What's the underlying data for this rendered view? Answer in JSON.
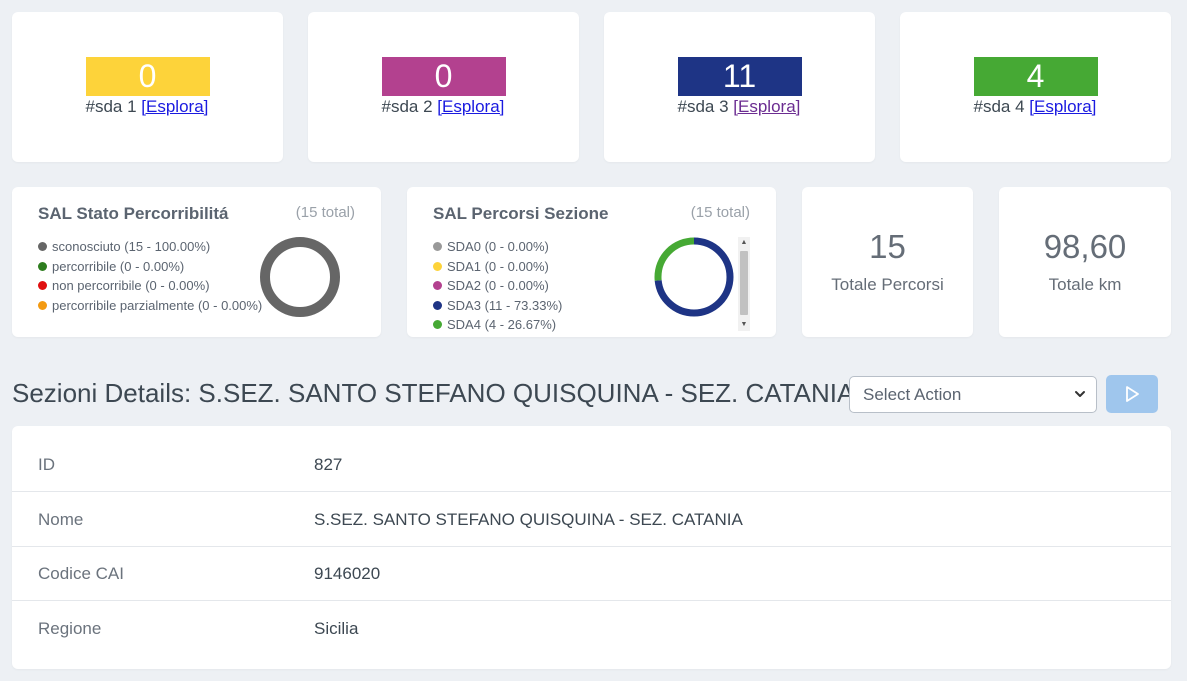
{
  "sda_cards": [
    {
      "count": "0",
      "label": "#sda 1",
      "link": "[Esplora]",
      "color": "#fdd33a"
    },
    {
      "count": "0",
      "label": "#sda 2",
      "link": "[Esplora]",
      "color": "#b3418f"
    },
    {
      "count": "11",
      "label": "#sda 3",
      "link": "[Esplora]",
      "color": "#1e3485"
    },
    {
      "count": "4",
      "label": "#sda 4",
      "link": "[Esplora]",
      "color": "#46a934"
    }
  ],
  "sal_stato": {
    "title": "SAL Stato Percorribilitá",
    "total": "(15 total)",
    "legend": [
      {
        "label": "sconosciuto (15 - 100.00%)",
        "color": "#666666"
      },
      {
        "label": "percorribile (0 - 0.00%)",
        "color": "#2e7d1f"
      },
      {
        "label": "non percorribile (0 - 0.00%)",
        "color": "#e01010"
      },
      {
        "label": "percorribile parzialmente (0 - 0.00%)",
        "color": "#f39a12"
      }
    ]
  },
  "sal_percorsi": {
    "title": "SAL Percorsi Sezione",
    "total": "(15 total)",
    "legend": [
      {
        "label": "SDA0 (0 - 0.00%)",
        "color": "#999999"
      },
      {
        "label": "SDA1 (0 - 0.00%)",
        "color": "#fdd33a"
      },
      {
        "label": "SDA2 (0 - 0.00%)",
        "color": "#b3418f"
      },
      {
        "label": "SDA3 (11 - 73.33%)",
        "color": "#1e3485"
      },
      {
        "label": "SDA4 (4 - 26.67%)",
        "color": "#46a934"
      }
    ]
  },
  "stats": {
    "percorsi_value": "15",
    "percorsi_label": "Totale Percorsi",
    "km_value": "98,60",
    "km_label": "Totale km"
  },
  "header": {
    "title": "Sezioni Details: S.SEZ. SANTO STEFANO QUISQUINA - SEZ. CATANIA",
    "select_label": "Select Action"
  },
  "details": [
    {
      "key": "ID",
      "value": "827"
    },
    {
      "key": "Nome",
      "value": "S.SEZ. SANTO STEFANO QUISQUINA - SEZ. CATANIA"
    },
    {
      "key": "Codice CAI",
      "value": "9146020"
    },
    {
      "key": "Regione",
      "value": "Sicilia"
    }
  ]
}
